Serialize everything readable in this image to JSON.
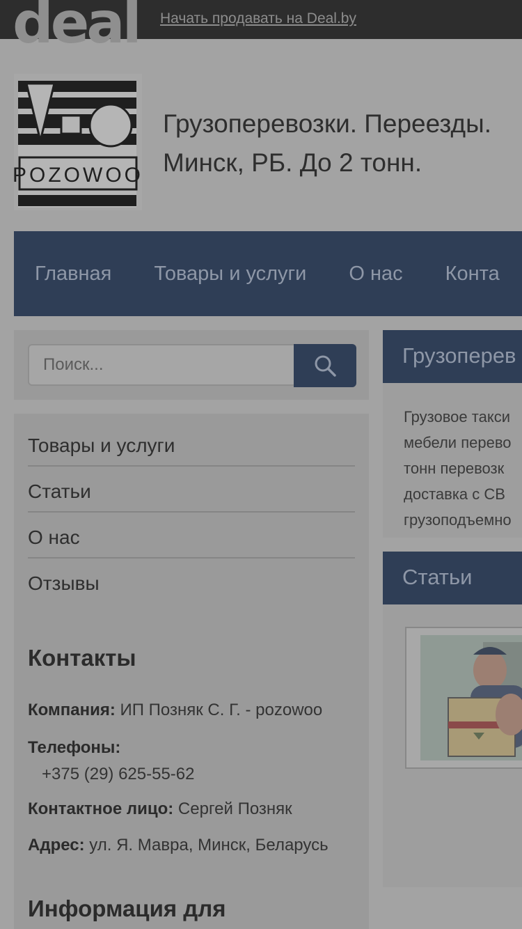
{
  "topbar": {
    "logo_text": "deal",
    "sell_link": "Начать продавать на Deal.by"
  },
  "shop": {
    "logo_text": "POZOWOO",
    "title_line1": "Грузоперевозки. Переезды.",
    "title_line2": "Минск, РБ. До 2 тонн."
  },
  "nav": {
    "items": [
      "Главная",
      "Товары и услуги",
      "О нас",
      "Конта"
    ]
  },
  "search": {
    "placeholder": "Поиск..."
  },
  "sidebar": {
    "menu": [
      "Товары и услуги",
      "Статьи",
      "О нас",
      "Отзывы"
    ],
    "contacts_heading": "Контакты",
    "company_label": "Компания:",
    "company_value": "ИП Позняк С. Г. - pozowoo",
    "phones_label": "Телефоны:",
    "phone": "+375 (29) 625-55-62",
    "person_label": "Контактное лицо:",
    "person_value": "Сергей Позняк",
    "address_label": "Адрес:",
    "address_value": "ул. Я. Мавра, Минск, Беларусь",
    "info_heading": "Информация для"
  },
  "main": {
    "about_heading": "Грузоперев",
    "about_lines": [
      "Грузовое такси",
      "мебели перево",
      "тонн перевозк",
      "доставка с СВ",
      "грузоподъемно"
    ],
    "articles_heading": "Статьи"
  },
  "colors": {
    "nav_bg": "#2f3e56",
    "topbar_bg": "#2d2d2d",
    "overlay_bg": "#a3a3a3"
  }
}
